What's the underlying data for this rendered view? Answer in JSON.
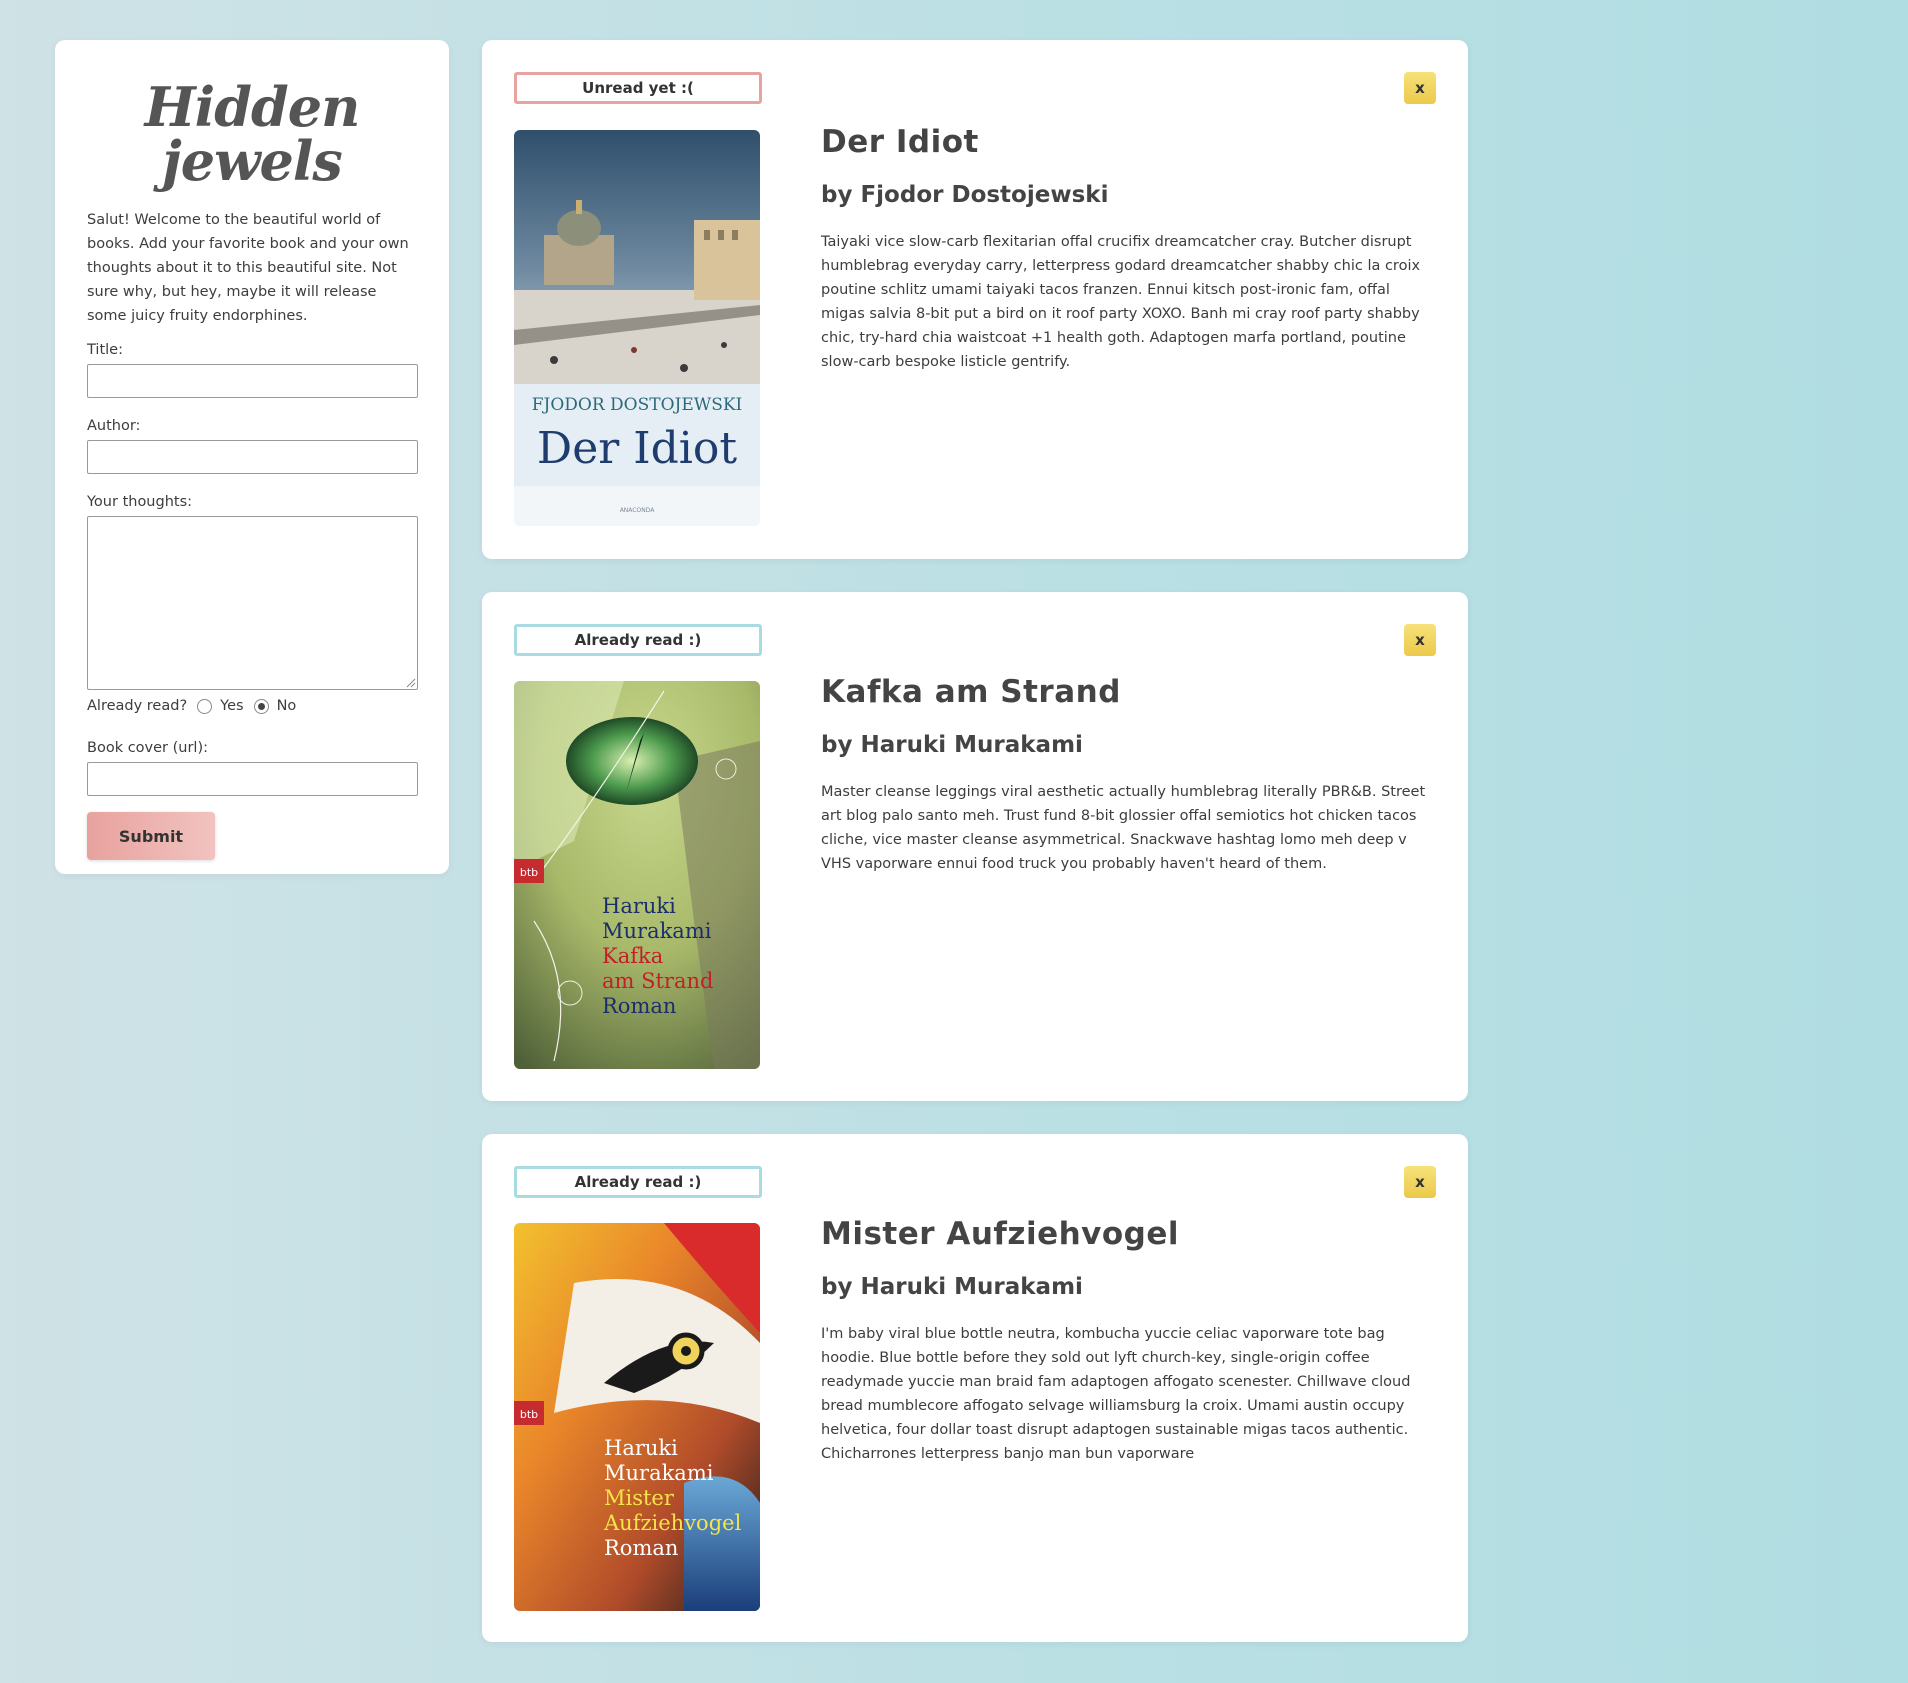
{
  "sidebar": {
    "brand": "Hidden jewels",
    "intro": "Salut! Welcome to the beautiful world of books. Add your favorite book and your own thoughts about it to this beautiful site. Not sure why, but hey, maybe it will release some juicy fruity endorphines.",
    "title_label": "Title:",
    "title_value": "",
    "author_label": "Author:",
    "author_value": "",
    "thoughts_label": "Your thoughts:",
    "thoughts_value": "",
    "already_read_label": "Already read?",
    "radio_yes": "Yes",
    "radio_no": "No",
    "radio_selected": "No",
    "cover_label": "Book cover (url):",
    "cover_value": "",
    "submit_label": "Submit"
  },
  "books": [
    {
      "status": "Unread yet :(",
      "status_kind": "unread",
      "close_label": "x",
      "title": "Der Idiot",
      "author": "by Fjodor Dostojewski",
      "thoughts": "Taiyaki vice slow-carb flexitarian offal crucifix dreamcatcher cray. Butcher disrupt humblebrag everyday carry, letterpress godard dreamcatcher shabby chic la croix poutine schlitz umami taiyaki tacos franzen. Ennui kitsch post-ironic fam, offal migas salvia 8-bit put a bird on it roof party XOXO. Banh mi cray roof party shabby chic, try-hard chia waistcoat +1 health goth. Adaptogen marfa portland, poutine slow-carb bespoke listicle gentrify.",
      "cover": {
        "author": "FJODOR DOSTOJEWSKI",
        "title": "Der Idiot",
        "publisher": "ANACONDA"
      }
    },
    {
      "status": "Already read :)",
      "status_kind": "read",
      "close_label": "x",
      "title": "Kafka am Strand",
      "author": "by Haruki Murakami",
      "thoughts": "Master cleanse leggings viral aesthetic actually humblebrag literally PBR&B. Street art blog palo santo meh. Trust fund 8-bit glossier offal semiotics hot chicken tacos cliche, vice master cleanse asymmetrical. Snackwave hashtag lomo meh deep v VHS vaporware ennui food truck you probably haven't heard of them.",
      "cover": {
        "badge": "btb",
        "line1": "Haruki",
        "line2": "Murakami",
        "line3": "Kafka",
        "line4": "am Strand",
        "line5": "Roman"
      }
    },
    {
      "status": "Already read :)",
      "status_kind": "read",
      "close_label": "x",
      "title": "Mister Aufziehvogel",
      "author": "by Haruki Murakami",
      "thoughts": "I'm baby viral blue bottle neutra, kombucha yuccie celiac vaporware tote bag hoodie. Blue bottle before they sold out lyft church-key, single-origin coffee readymade yuccie man braid fam adaptogen affogato scenester. Chillwave cloud bread mumblecore affogato selvage williamsburg la croix. Umami austin occupy helvetica, four dollar toast disrupt adaptogen sustainable migas tacos authentic. Chicharrones letterpress banjo man bun vaporware",
      "cover": {
        "badge": "btb",
        "line1": "Haruki",
        "line2": "Murakami",
        "line3": "Mister",
        "line4": "Aufziehvogel",
        "line5": "Roman"
      }
    }
  ]
}
